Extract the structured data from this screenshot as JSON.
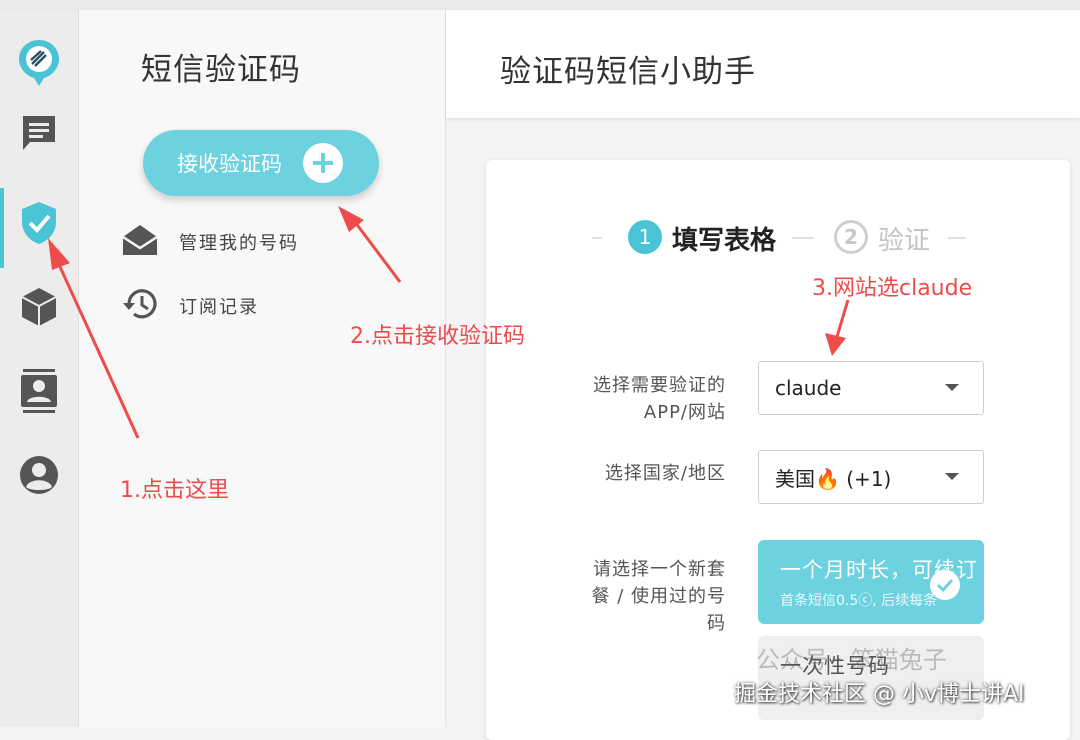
{
  "sidebar_icons": [
    {
      "name": "app-logo-icon",
      "active": false
    },
    {
      "name": "message-icon",
      "active": false
    },
    {
      "name": "shield-check-icon",
      "active": true
    },
    {
      "name": "cube-icon",
      "active": false
    },
    {
      "name": "contacts-icon",
      "active": false
    },
    {
      "name": "account-icon",
      "active": false
    }
  ],
  "menu": {
    "title": "短信验证码",
    "receive_button": "接收验证码",
    "items": [
      {
        "label": "管理我的号码",
        "icon": "envelope-open-icon"
      },
      {
        "label": "订阅记录",
        "icon": "history-icon"
      }
    ]
  },
  "header": {
    "title": "验证码短信小助手"
  },
  "stepper": {
    "step1": {
      "number": "1",
      "label": "填写表格"
    },
    "step2": {
      "number": "2",
      "label": "验证"
    }
  },
  "form": {
    "app_label_line1": "选择需要验证的",
    "app_label_line2": "APP/网站",
    "app_value": "claude",
    "country_label": "选择国家/地区",
    "country_value": "美国🔥 (+1)",
    "plan_label_line1": "请选择一个新套",
    "plan_label_line2": "餐 / 使用过的号",
    "plan_label_line3": "码",
    "plan1_title": "一个月时长，可续订",
    "plan1_sub": "首条短信0.5ⓒ, 后续每条",
    "plan2_title": "一次性号码"
  },
  "annotations": {
    "a1": "1.点击这里",
    "a2": "2.点击接收验证码",
    "a3": "3.网站选claude"
  },
  "watermark": {
    "main": "掘金技术社区 @ 小v博士讲AI",
    "faint": "公众号 · 笨猫兔子"
  },
  "colors": {
    "accent": "#6dd2df",
    "annotation": "#ee4b4b"
  }
}
